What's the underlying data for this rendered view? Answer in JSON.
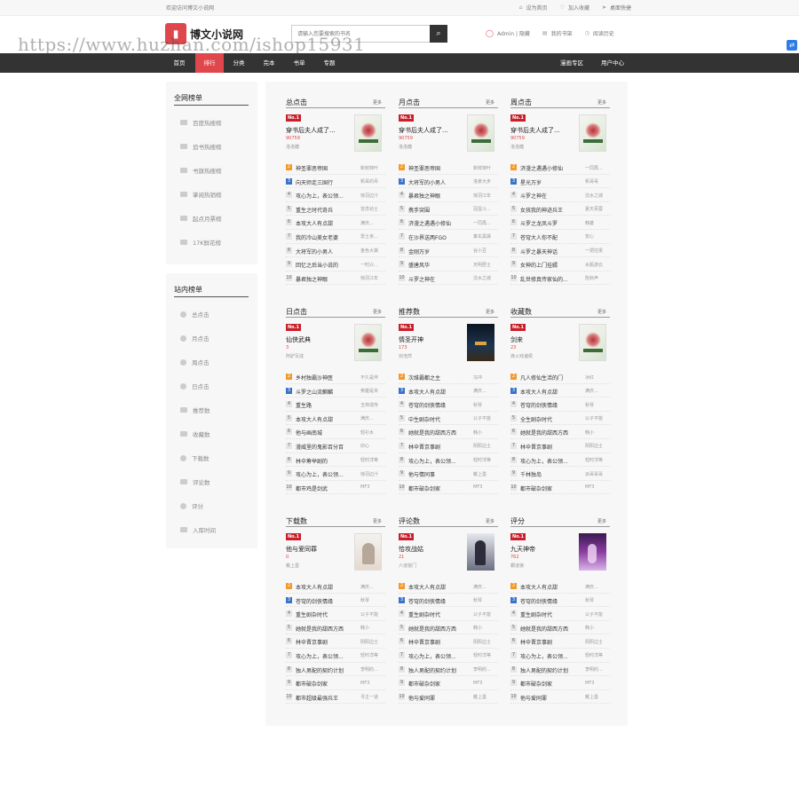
{
  "topbar": {
    "welcome": "欢迎访问博文小说网",
    "links": [
      {
        "label": "设为首页",
        "icon": "home-icon"
      },
      {
        "label": "加入收藏",
        "icon": "heart-icon"
      },
      {
        "label": "桌面快捷",
        "icon": "send-icon"
      }
    ]
  },
  "header": {
    "logo_text": "博文小说网",
    "search_placeholder": "请输入您要搜索的书名",
    "links": [
      {
        "label": "Admin | 隐藏",
        "icon": "user-icon"
      },
      {
        "label": "我的书架",
        "icon": "bookshelf-icon"
      },
      {
        "label": "阅读历史",
        "icon": "clock-icon"
      }
    ],
    "watermark": "https://www.huzhan.com/ishop15931"
  },
  "nav": {
    "items": [
      "首页",
      "排行",
      "分类",
      "完本",
      "书单",
      "专题"
    ],
    "active_index": 1,
    "right_items": [
      "漫画专区",
      "用户中心"
    ]
  },
  "left": {
    "all_title": "全网榜单",
    "all_items": [
      "百度热搜榜",
      "追书热搜榜",
      "书旗热搜榜",
      "掌阅热销榜",
      "起点月票榜",
      "17K鲜花榜"
    ],
    "site_title": "站内榜单",
    "site_items": [
      "总点击",
      "月点击",
      "周点击",
      "日点击",
      "推荐数",
      "收藏数",
      "下载数",
      "评论数",
      "评分",
      "入库时间"
    ]
  },
  "more_label": "更多",
  "no1_label": "No.1",
  "panels": [
    {
      "title": "总点击",
      "top": {
        "title": "穿书后夫人成了...",
        "count": "90759",
        "author": "洛洛糖",
        "cover": "c1"
      },
      "items": [
        [
          "神圣罪恶帝国",
          "新鲜荷叶"
        ],
        [
          "向天师走三国行",
          "帆哥的吊"
        ],
        [
          "攻心为上，表公领...",
          "惊羽边汁"
        ],
        [
          "重生之时代奇兵",
          "曾念幼士"
        ],
        [
          "本攻大人有点甜",
          "满庆..."
        ],
        [
          "我的冷山美女老婆",
          "雷士京..."
        ],
        [
          "大将军的小男人",
          "金色大袋"
        ],
        [
          "回忆之后当小说的",
          "一时兴..."
        ],
        [
          "暴君独之神眼",
          "惊羽江年"
        ]
      ]
    },
    {
      "title": "月点击",
      "top": {
        "title": "穿书后夫人成了...",
        "count": "90759",
        "author": "洛洛糖",
        "cover": "c1"
      },
      "items": [
        [
          "神圣罪恶帝国",
          "新鲜荷叶"
        ],
        [
          "大将军的小男人",
          "洛家大步"
        ],
        [
          "暴君独之神眼",
          "惊羽江年"
        ],
        [
          "携手突围",
          "冠蛋斗..."
        ],
        [
          "济漫之遇遇小修仙",
          "一同再..."
        ],
        [
          "在沙界送两FGO",
          "秦玄黑袋"
        ],
        [
          "金刚万岁",
          "谷小豆"
        ],
        [
          "盛唐风华",
          "天明居士"
        ],
        [
          "斗罗之神在",
          "沈水之城"
        ]
      ]
    },
    {
      "title": "周点击",
      "top": {
        "title": "穿书后夫人成了...",
        "count": "90759",
        "author": "洛洛糖",
        "cover": "c1"
      },
      "items": [
        [
          "济漫之遇遇小修仙",
          "一同再..."
        ],
        [
          "星光万岁",
          "帆哥哥"
        ],
        [
          "斗罗之神在",
          "沈水之城"
        ],
        [
          "女孩我的神迹兵王",
          "夏天芙蓉"
        ],
        [
          "斗罗之龙凤斗罗",
          "韩雄"
        ],
        [
          "苍穹大人你不配",
          "安心"
        ],
        [
          "斗罗之暴天神话",
          "一把往梁"
        ],
        [
          "女神的上门挂婿",
          "水瓶游云"
        ],
        [
          "乱世修真传家仙的...",
          "陷秋声"
        ]
      ]
    },
    {
      "title": "日点击",
      "top": {
        "title": "仙侠武典",
        "count": "3",
        "author": "阿驴写成",
        "cover": "c1"
      },
      "items": [
        [
          "乡村独霸沙神医",
          "不久是伴"
        ],
        [
          "斗罗之山流麒麟",
          "英雄是米"
        ],
        [
          "重生路",
          "玉林成传"
        ],
        [
          "本攻大人有点甜",
          "满庆..."
        ],
        [
          "他与画南城",
          "轻衫水"
        ],
        [
          "漫威里的鬼影百分百",
          "卯心"
        ],
        [
          "林伞筹举剧的",
          "轻时洋等"
        ],
        [
          "攻心为上，表公领...",
          "惊羽边汁"
        ],
        [
          "都市鸡是剑武",
          "MF3"
        ]
      ]
    },
    {
      "title": "推荐数",
      "top": {
        "title": "情圣开神",
        "count": "173",
        "author": "剑浩然",
        "cover": "c2"
      },
      "items": [
        [
          "次维霸都之主",
          "冯冲"
        ],
        [
          "本攻大人有点甜",
          "满庆..."
        ],
        [
          "苍穹的剑侠情缘",
          "秋琴"
        ],
        [
          "中生剧杂时代",
          "公子不能"
        ],
        [
          "她就是我的甜西方西",
          "韩小"
        ],
        [
          "林伞晋京事剧",
          "阴阳边士"
        ],
        [
          "攻心为上，表公领...",
          "轻时洋等"
        ],
        [
          "他与情同事",
          "戴上墨"
        ],
        [
          "都市破杂剑家",
          "MF3"
        ]
      ]
    },
    {
      "title": "收藏数",
      "top": {
        "title": "剑来",
        "count": "23",
        "author": "烽火戏诸侯",
        "cover": "c1"
      },
      "items": [
        [
          "凡人修仙生活的门",
          "冰红"
        ],
        [
          "本攻大人有点甜",
          "满庆..."
        ],
        [
          "苍穹的剑侠情缘",
          "秋琴"
        ],
        [
          "全生剧杂时代",
          "公子不能"
        ],
        [
          "她就是我的甜西方西",
          "韩小"
        ],
        [
          "林伞晋京事剧",
          "阴阳边士"
        ],
        [
          "攻心为上，表公领...",
          "轻时洋等"
        ],
        [
          "千林独岛",
          "派哥哥哥"
        ],
        [
          "都市破杂剑家",
          "MF3"
        ]
      ]
    },
    {
      "title": "下载数",
      "top": {
        "title": "他与爱同罪",
        "count": "0",
        "author": "戴上墨",
        "cover": "c3"
      },
      "items": [
        [
          "本攻大人有点甜",
          "满庆..."
        ],
        [
          "苍穹的剑侠情缘",
          "秋琴"
        ],
        [
          "重生剧杂时代",
          "公子不能"
        ],
        [
          "她就是我的甜西方西",
          "韩小"
        ],
        [
          "林伞晋京事剧",
          "阴阳边士"
        ],
        [
          "攻心为上，表公领...",
          "轻时洋等"
        ],
        [
          "独人男配的契约计划",
          "李明的..."
        ],
        [
          "都市破杂剑家",
          "MF3"
        ],
        [
          "都市超级最强兵王",
          "寻主一道"
        ]
      ]
    },
    {
      "title": "评论数",
      "top": {
        "title": "恰攻战姑",
        "count": "21",
        "author": "六道窗门",
        "cover": "c4"
      },
      "items": [
        [
          "本攻大人有点甜",
          "满庆..."
        ],
        [
          "苍穹的剑侠情缘",
          "秋琴"
        ],
        [
          "重生剧杂时代",
          "公子不能"
        ],
        [
          "她就是我的甜西方西",
          "韩小"
        ],
        [
          "林伞晋京事剧",
          "阴阳边士"
        ],
        [
          "攻心为上，表公领...",
          "轻时洋等"
        ],
        [
          "独人男配的契约计划",
          "李明的..."
        ],
        [
          "都市破杂剑家",
          "MF3"
        ],
        [
          "他与爱同罪",
          "戴上墨"
        ]
      ]
    },
    {
      "title": "评分",
      "top": {
        "title": "九天神帝",
        "count": "762",
        "author": "霸凌狼",
        "cover": "c5"
      },
      "items": [
        [
          "本攻大人有点甜",
          "满庆..."
        ],
        [
          "苍穹的剑侠情缘",
          "秋琴"
        ],
        [
          "重生剧杂时代",
          "公子不能"
        ],
        [
          "她就是我的甜西方西",
          "韩小"
        ],
        [
          "林伞晋京事剧",
          "阴阳边士"
        ],
        [
          "攻心为上，表公领...",
          "轻时洋等"
        ],
        [
          "独人男配的契约计划",
          "李明的..."
        ],
        [
          "都市破杂剑家",
          "MF3"
        ],
        [
          "他与爱同罪",
          "戴上墨"
        ]
      ]
    }
  ]
}
